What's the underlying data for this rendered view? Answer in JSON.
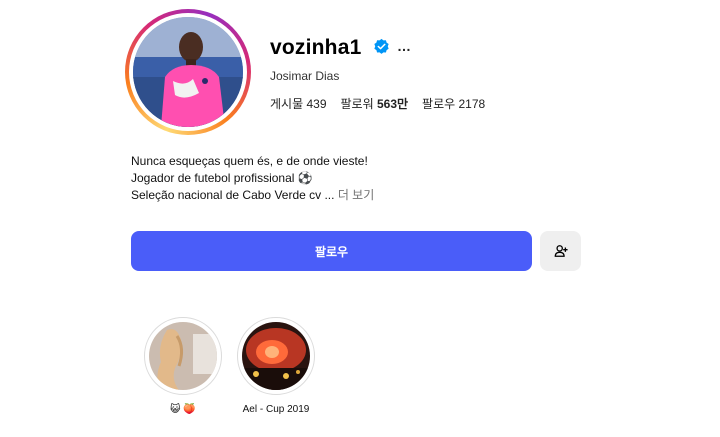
{
  "profile": {
    "username": "vozinha1",
    "full_name": "Josimar Dias",
    "more_icon": "…"
  },
  "stats": {
    "posts_label": "게시물",
    "posts_value": "439",
    "followers_label": "팔로워",
    "followers_value": "563만",
    "following_label": "팔로우",
    "following_value": "2178"
  },
  "bio": {
    "line1": "Nunca esqueças quem és, e de onde vieste!",
    "line2": "Jogador de futebol profissional",
    "line2_emoji": "⚽",
    "line3": "Seleção nacional de Cabo Verde cv ...",
    "more_label": "더 보기"
  },
  "actions": {
    "follow_label": "팔로우"
  },
  "highlights": [
    {
      "label": "😺 🍑"
    },
    {
      "label": "Ael - Cup 2019"
    }
  ],
  "colors": {
    "follow_button": "#4a5df9",
    "verified_badge": "#0095f6",
    "secondary_button": "#efefef"
  }
}
